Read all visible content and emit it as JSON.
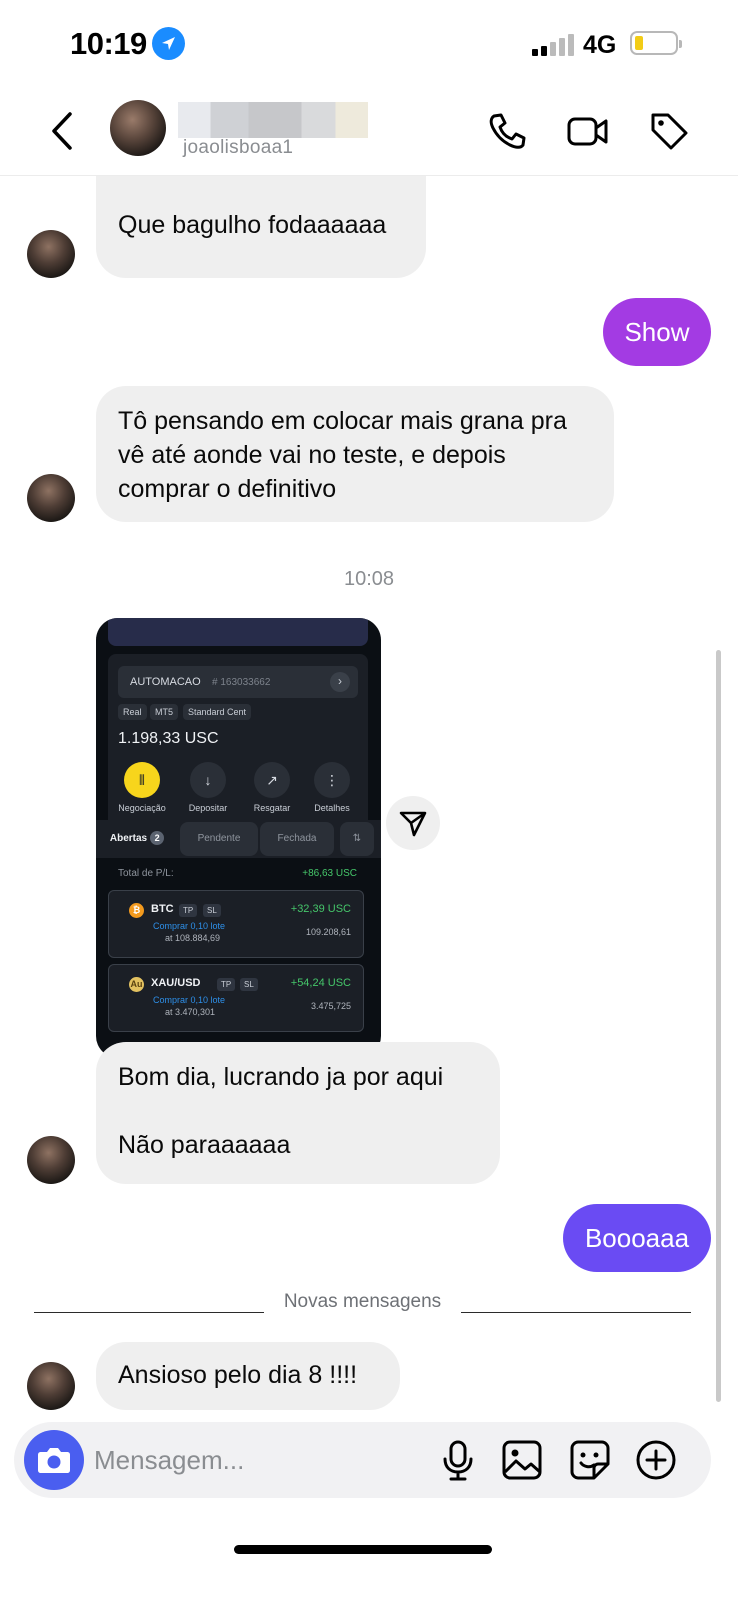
{
  "status_bar": {
    "time": "10:19",
    "network": "4G"
  },
  "header": {
    "username": "joaolisboaa1"
  },
  "messages": {
    "m1": "Lucro de hoje !!!!!\n\nQue bagulho fodaaaaaa",
    "m2": "Show",
    "m3": "Tô pensando em colocar mais grana pra vê até aonde vai no teste, e depois comprar o definitivo",
    "timestamp": "10:08",
    "m4": "Bom dia, lucrando ja por aqui\n\nNão paraaaaaa",
    "m5": "Boooaaa",
    "new_messages_label": "Novas mensagens",
    "m6": "Ansioso pelo dia 8 !!!!"
  },
  "trading_screenshot": {
    "account_name": "AUTOMACAO",
    "account_id": "# 163033662",
    "tags": [
      "Real",
      "MT5",
      "Standard Cent"
    ],
    "balance": "1.198,33 USC",
    "actions": [
      "Negociação",
      "Depositar",
      "Resgatar",
      "Detalhes"
    ],
    "tabs": {
      "open": "Abertas",
      "open_count": "2",
      "pending": "Pendente",
      "closed": "Fechada"
    },
    "total_pl_label": "Total de P/L:",
    "total_pl_value": "+86,63 USC",
    "positions": [
      {
        "symbol": "BTC",
        "tp": "TP",
        "sl": "SL",
        "profit": "+32,39 USC",
        "order": "Comprar 0,10 lote",
        "open_price": "at 108.884,69",
        "current_price": "109.208,61"
      },
      {
        "symbol": "XAU/USD",
        "tp": "TP",
        "sl": "SL",
        "profit": "+54,24 USC",
        "order": "Comprar 0,10 lote",
        "open_price": "at 3.470,301",
        "current_price": "3.475,725"
      }
    ]
  },
  "composer": {
    "placeholder": "Mensagem..."
  },
  "colors": {
    "outgoing_1": "#a33be3",
    "outgoing_2": "#6a4bf3",
    "incoming": "#efefef",
    "camera_button": "#4a5ef0",
    "profit": "#45c66a"
  },
  "icons": [
    "back-arrow-icon",
    "phone-icon",
    "video-icon",
    "tag-icon",
    "send-icon",
    "camera-icon",
    "microphone-icon",
    "gallery-icon",
    "sticker-icon",
    "plus-circle-icon"
  ]
}
